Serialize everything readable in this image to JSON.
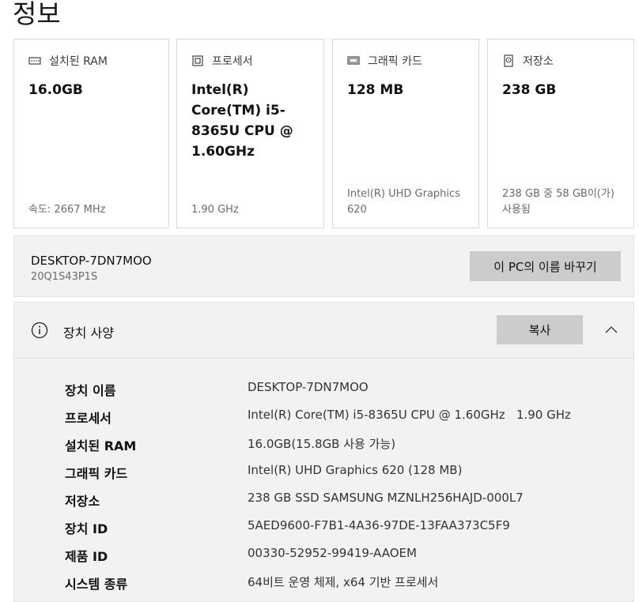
{
  "page": {
    "title": "정보"
  },
  "cards": {
    "ram": {
      "icon": "ram-icon",
      "label": "설치된 RAM",
      "value": "16.0GB",
      "foot": "속도: 2667 MHz"
    },
    "cpu": {
      "icon": "processor-icon",
      "label": "프로세서",
      "value": "Intel(R) Core(TM) i5-8365U CPU @ 1.60GHz",
      "foot": "1.90 GHz"
    },
    "gpu": {
      "icon": "graphics-card-icon",
      "label": "그래픽 카드",
      "value": "128 MB",
      "foot": "Intel(R) UHD Graphics 620"
    },
    "storage": {
      "icon": "storage-icon",
      "label": "저장소",
      "value": "238 GB",
      "foot": "238 GB 중 58 GB이(가) 사용됨"
    }
  },
  "pc": {
    "name": "DESKTOP-7DN7MOO",
    "id": "20Q1S43P1S",
    "rename_label": "이 PC의 이름 바꾸기"
  },
  "specs": {
    "title": "장치 사양",
    "copy_label": "복사",
    "rows": [
      {
        "label": "장치 이름",
        "value": "DESKTOP-7DN7MOO"
      },
      {
        "label": "프로세서",
        "value": "Intel(R) Core(TM) i5-8365U CPU @ 1.60GHz   1.90 GHz"
      },
      {
        "label": "설치된 RAM",
        "value": "16.0GB(15.8GB 사용 가능)"
      },
      {
        "label": "그래픽 카드",
        "value": "Intel(R) UHD Graphics 620 (128 MB)"
      },
      {
        "label": "저장소",
        "value": "238 GB SSD SAMSUNG MZNLH256HAJD-000L7"
      },
      {
        "label": "장치 ID",
        "value": "5AED9600-F7B1-4A36-97DE-13FAA373C5F9"
      },
      {
        "label": "제품 ID",
        "value": "00330-52952-99419-AAOEM"
      },
      {
        "label": "시스템 종류",
        "value": "64비트 운영 체제, x64 기반 프로세서"
      }
    ]
  }
}
